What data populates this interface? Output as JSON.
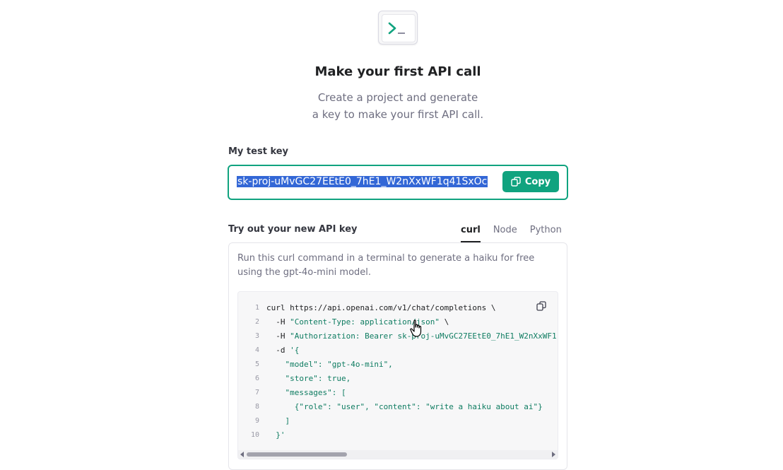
{
  "header": {
    "icon": "terminal-icon",
    "title": "Make your first API call",
    "subtitle_line1": "Create a project and generate",
    "subtitle_line2": "a key to make your first API call."
  },
  "test_key": {
    "label": "My test key",
    "value": "sk-proj-uMvGC27EEtE0_7hE1_W2nXxWF1q41SxOc",
    "copy_label": "Copy",
    "copy_icon": "copy-icon"
  },
  "try_out": {
    "label": "Try out your new API key",
    "tabs": [
      "curl",
      "Node",
      "Python"
    ],
    "active_tab": "curl",
    "description": "Run this curl command in a terminal to generate a haiku for free using the gpt-4o-mini model.",
    "code_lines": [
      {
        "n": "1",
        "plain": "curl https://api.openai.com/v1/chat/completions \\",
        "str": ""
      },
      {
        "n": "2",
        "plain": "  -H ",
        "str": "\"Content-Type: application/json\"",
        "tail": " \\"
      },
      {
        "n": "3",
        "plain": "  -H ",
        "str": "\"Authorization: Bearer sk-proj-uMvGC27EEtE0_7hE1_W2nXxWF1",
        "tail": ""
      },
      {
        "n": "4",
        "plain": "  -d ",
        "str": "'{",
        "tail": ""
      },
      {
        "n": "5",
        "plain": "",
        "str": "    \"model\": \"gpt-4o-mini\",",
        "tail": ""
      },
      {
        "n": "6",
        "plain": "",
        "str": "    \"store\": true,",
        "tail": ""
      },
      {
        "n": "7",
        "plain": "",
        "str": "    \"messages\": [",
        "tail": ""
      },
      {
        "n": "8",
        "plain": "",
        "str": "      {\"role\": \"user\", \"content\": \"write a haiku about ai\"}",
        "tail": ""
      },
      {
        "n": "9",
        "plain": "",
        "str": "    ]",
        "tail": ""
      },
      {
        "n": "10",
        "plain": "",
        "str": "  }'",
        "tail": ""
      }
    ]
  },
  "colors": {
    "accent": "#10a37f",
    "selection": "#3367d6",
    "code_string": "#0e7c61"
  }
}
